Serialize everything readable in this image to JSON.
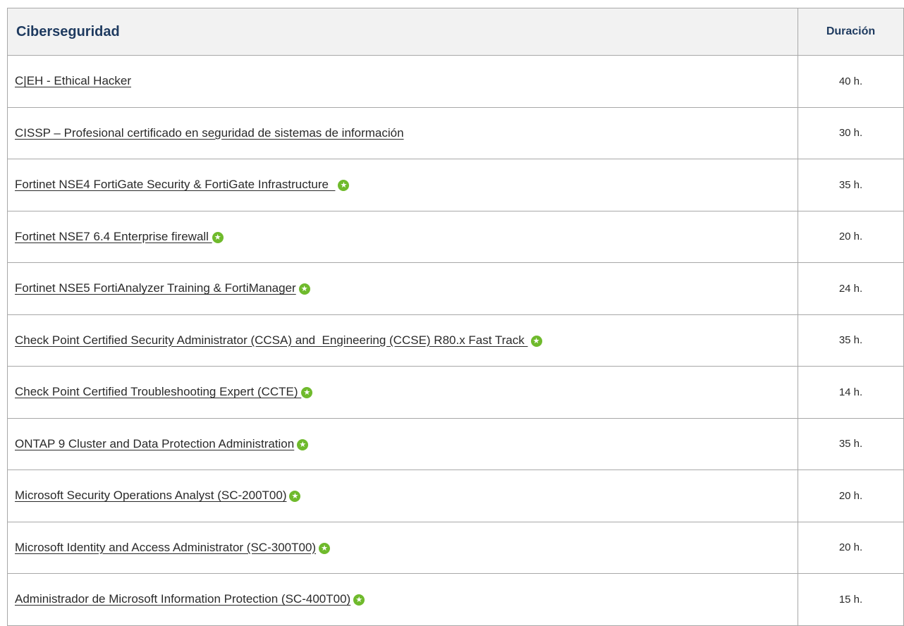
{
  "table": {
    "header": {
      "title": "Ciberseguridad",
      "duration": "Duración"
    },
    "rows": [
      {
        "course": "C|EH - Ethical Hacker",
        "duration": "40 h.",
        "featured": false
      },
      {
        "course": "CISSP – Profesional certificado en seguridad de sistemas de información",
        "duration": "30 h.",
        "featured": false
      },
      {
        "course": "Fortinet NSE4 FortiGate Security & FortiGate Infrastructure  ",
        "duration": "35 h.",
        "featured": true
      },
      {
        "course": "Fortinet NSE7 6.4 Enterprise firewall ",
        "duration": "20 h.",
        "featured": true
      },
      {
        "course": "Fortinet NSE5 FortiAnalyzer Training & FortiManager",
        "duration": "24 h.",
        "featured": true
      },
      {
        "course": "Check Point Certified Security Administrator (CCSA) and  Engineering (CCSE) R80.x Fast Track ",
        "duration": "35 h.",
        "featured": true
      },
      {
        "course": "Check Point Certified Troubleshooting Expert (CCTE) ",
        "duration": "14 h.",
        "featured": true
      },
      {
        "course": "ONTAP 9 Cluster and Data Protection Administration",
        "duration": "35 h.",
        "featured": true
      },
      {
        "course": "Microsoft Security Operations Analyst (SC-200T00)",
        "duration": "20 h.",
        "featured": true
      },
      {
        "course": "Microsoft Identity and Access Administrator (SC-300T00)",
        "duration": "20 h.",
        "featured": true
      },
      {
        "course": "Administrador de Microsoft Information Protection (SC-400T00)",
        "duration": "15 h.",
        "featured": true
      }
    ]
  },
  "icons": {
    "featured": "star-icon"
  },
  "colors": {
    "header_text": "#1e3a5f",
    "header_bg": "#f2f2f2",
    "border": "#a8a8a8",
    "star_badge": "#6fba2c"
  }
}
